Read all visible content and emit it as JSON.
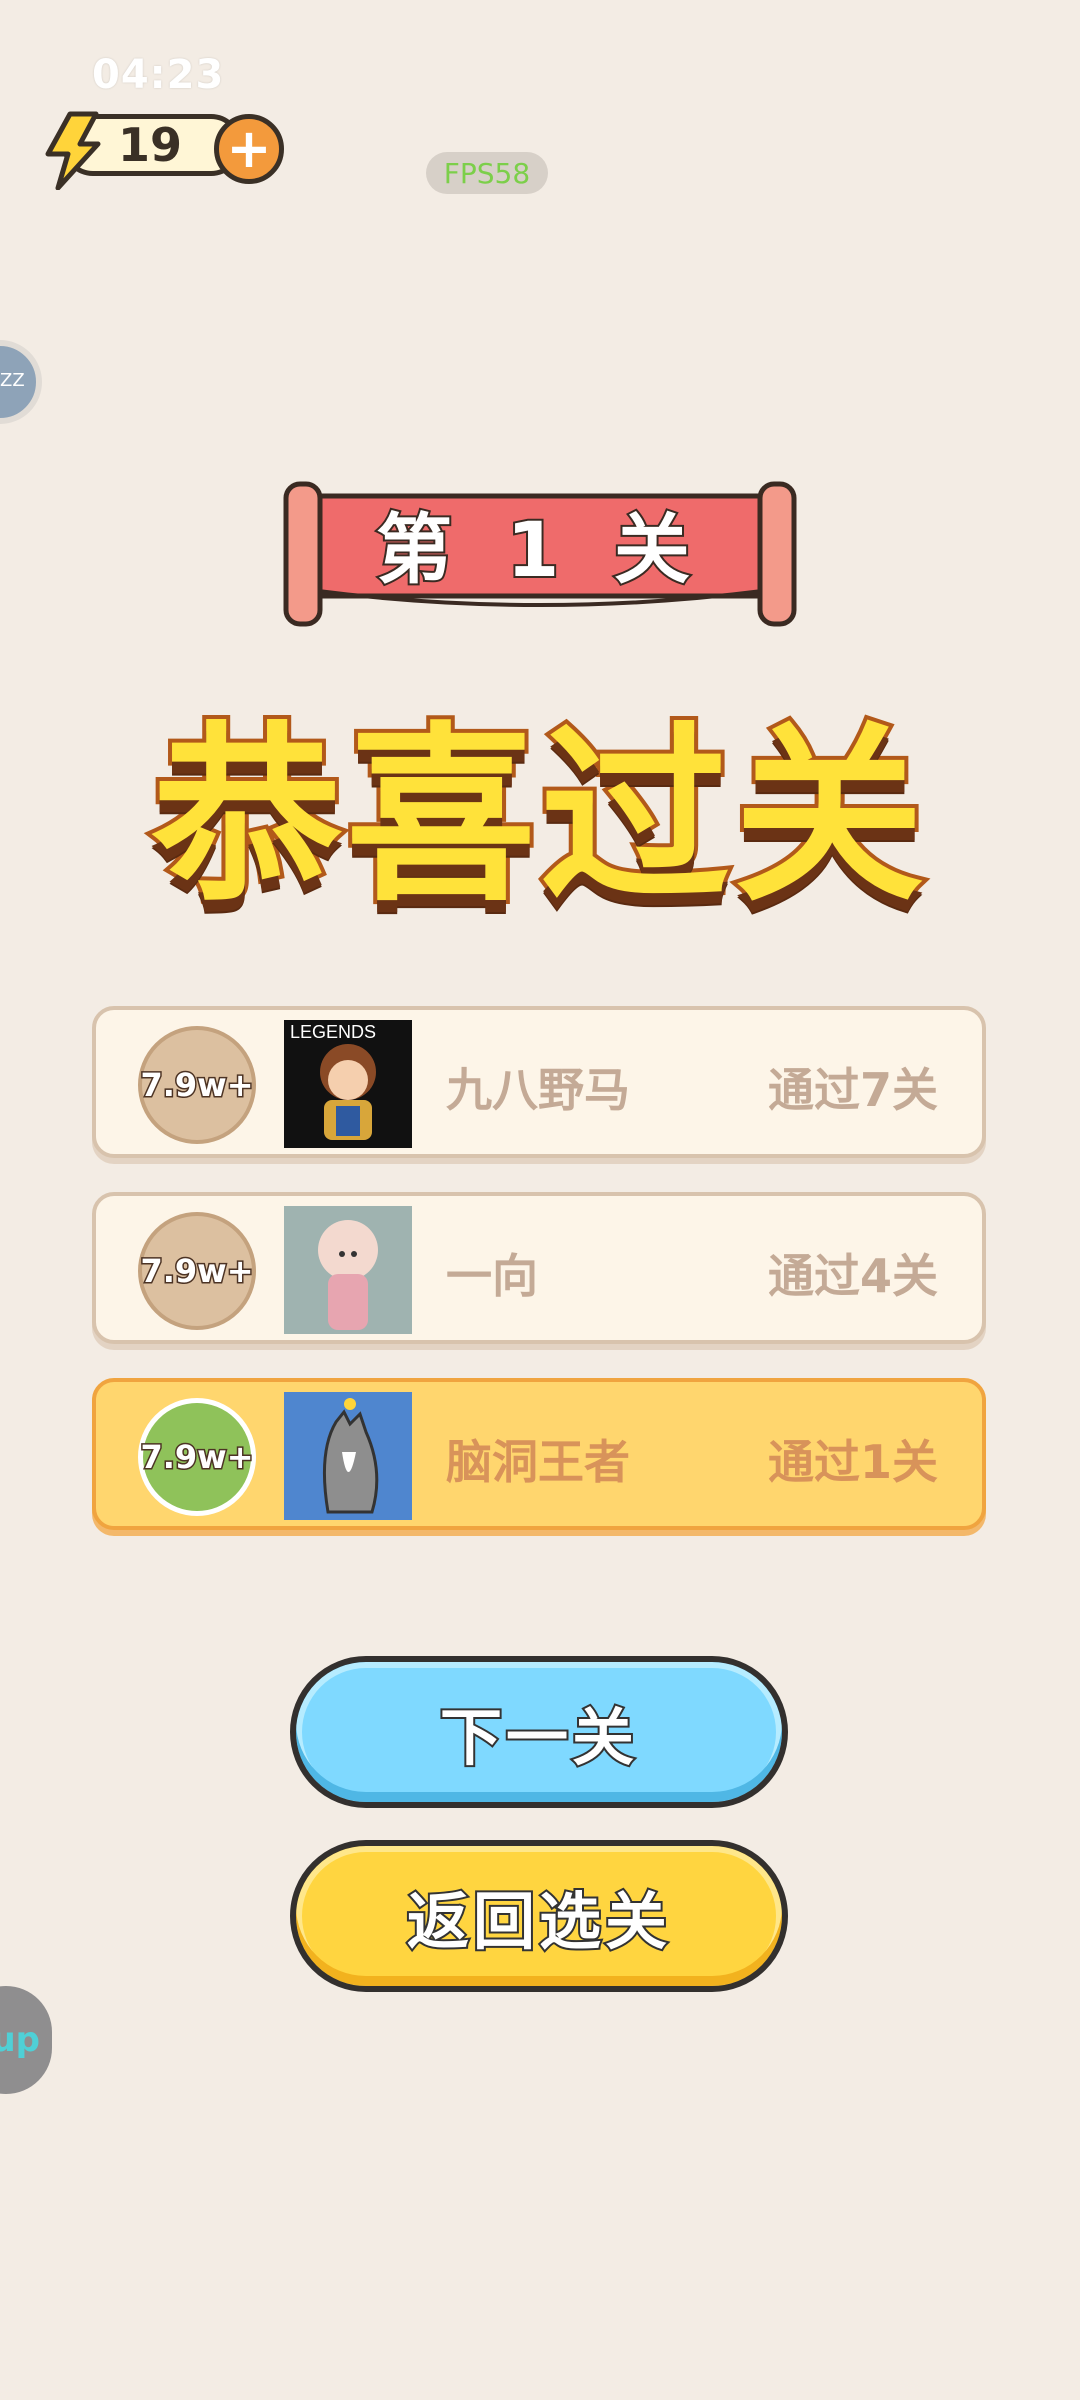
{
  "status_bar": {
    "time": "04:23"
  },
  "energy": {
    "value": "19",
    "icon": "lightning-bolt-icon",
    "add_icon": "plus-icon"
  },
  "fps": "FPS58",
  "side_widgets": {
    "bubble_text": "ZZ",
    "sup_label": "up"
  },
  "level_banner": "第 1 关",
  "headline": "恭喜过关",
  "leaderboard": [
    {
      "badge": "7.9w+",
      "name": "九八野马",
      "progress": "通过7关",
      "avatar_caption": "LEGENDS"
    },
    {
      "badge": "7.9w+",
      "name": "一向",
      "progress": "通过4关"
    },
    {
      "badge": "7.9w+",
      "name": "脑洞王者",
      "progress": "通过1关"
    }
  ],
  "buttons": {
    "next": "下一关",
    "back": "返回选关"
  },
  "colors": {
    "background": "#f3ece4",
    "banner": "#ef6b6b",
    "headline": "#ffe23a",
    "current_row": "#ffd66e",
    "next_button": "#7fd9ff",
    "back_button": "#ffd540"
  }
}
